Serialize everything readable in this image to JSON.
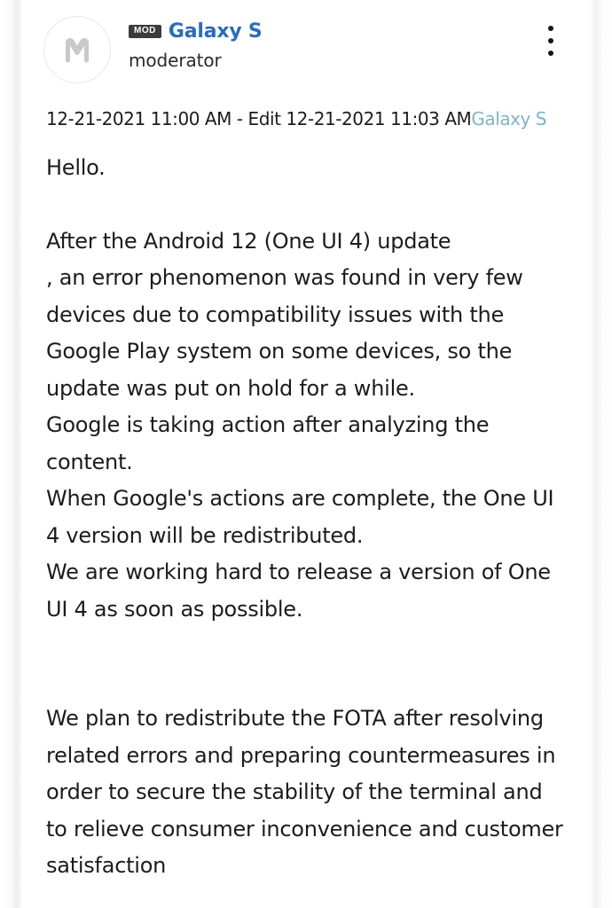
{
  "post": {
    "avatar": {
      "icon": "moderator-m-avatar-icon",
      "letter": "M"
    },
    "badge_label": "MOD",
    "board_name": "Galaxy S",
    "role": "moderator",
    "menu_icon": "kebab-menu-icon",
    "meta": {
      "timestamp": "12-21-2021 11:00 AM - Edit 12-21-2021 11:03 AM",
      "board_link": "Galaxy S"
    },
    "body": {
      "greeting": "Hello.",
      "paragraph_1": "After the Android 12 (One UI 4) update\n, an error phenomenon was found in very few devices due to compatibility issues with the Google Play system on some devices, so the update was put on hold for a while.\nGoogle is taking action after analyzing the content.\nWhen Google's actions are complete, the One UI 4 version will be redistributed.\nWe are working hard to release a version of One UI 4 as soon as possible.",
      "paragraph_2": "We plan to redistribute the FOTA after resolving related errors and preparing countermeasures in order to secure the stability of the terminal and to relieve consumer inconvenience and customer satisfaction"
    }
  },
  "colors": {
    "board_blue": "#2b6cb8",
    "meta_link_teal": "#7fb4c4",
    "badge_bg": "#3b3b3b",
    "text": "#1c1c1c",
    "page_bg": "#ffffff"
  }
}
